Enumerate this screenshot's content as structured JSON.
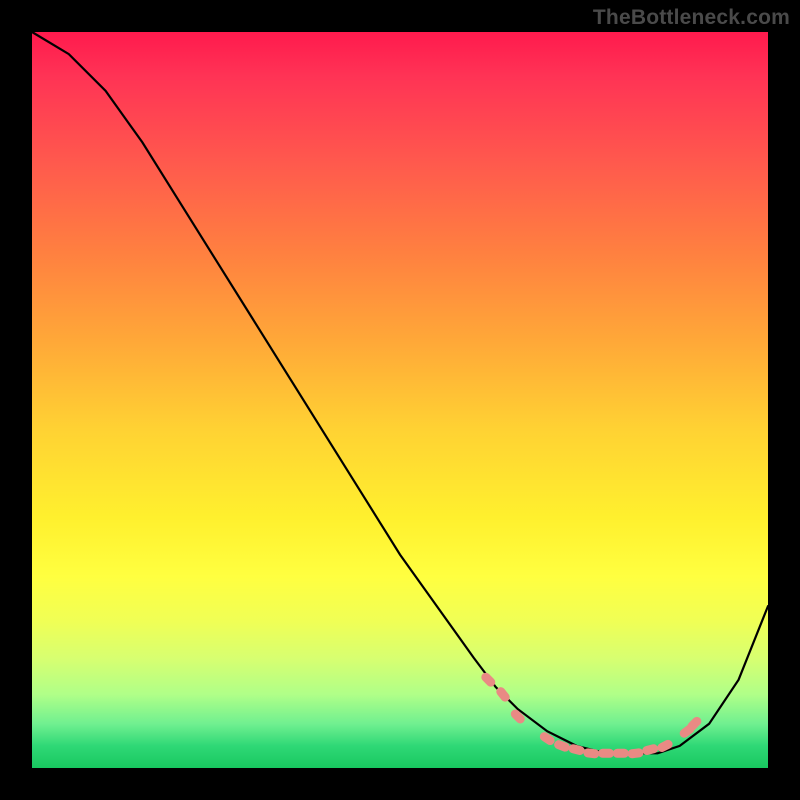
{
  "watermark": "TheBottleneck.com",
  "chart_data": {
    "type": "line",
    "title": "",
    "xlabel": "",
    "ylabel": "",
    "xlim": [
      0,
      100
    ],
    "ylim": [
      0,
      100
    ],
    "grid": false,
    "legend": false,
    "series": [
      {
        "name": "bottleneck-curve",
        "x": [
          0,
          5,
          10,
          15,
          20,
          25,
          30,
          35,
          40,
          45,
          50,
          55,
          60,
          63,
          66,
          70,
          74,
          78,
          82,
          85,
          88,
          92,
          96,
          100
        ],
        "y": [
          100,
          97,
          92,
          85,
          77,
          69,
          61,
          53,
          45,
          37,
          29,
          22,
          15,
          11,
          8,
          5,
          3,
          2,
          2,
          2,
          3,
          6,
          12,
          22
        ],
        "color": "#000000"
      }
    ],
    "markers": [
      {
        "name": "highlight-dots",
        "shape": "pill",
        "color": "#e98a84",
        "points": [
          {
            "x": 62,
            "y": 12
          },
          {
            "x": 64,
            "y": 10
          },
          {
            "x": 66,
            "y": 7
          },
          {
            "x": 70,
            "y": 4
          },
          {
            "x": 72,
            "y": 3
          },
          {
            "x": 74,
            "y": 2.5
          },
          {
            "x": 76,
            "y": 2
          },
          {
            "x": 78,
            "y": 2
          },
          {
            "x": 80,
            "y": 2
          },
          {
            "x": 82,
            "y": 2
          },
          {
            "x": 84,
            "y": 2.5
          },
          {
            "x": 86,
            "y": 3
          },
          {
            "x": 89,
            "y": 5
          },
          {
            "x": 90,
            "y": 6
          }
        ]
      }
    ]
  }
}
